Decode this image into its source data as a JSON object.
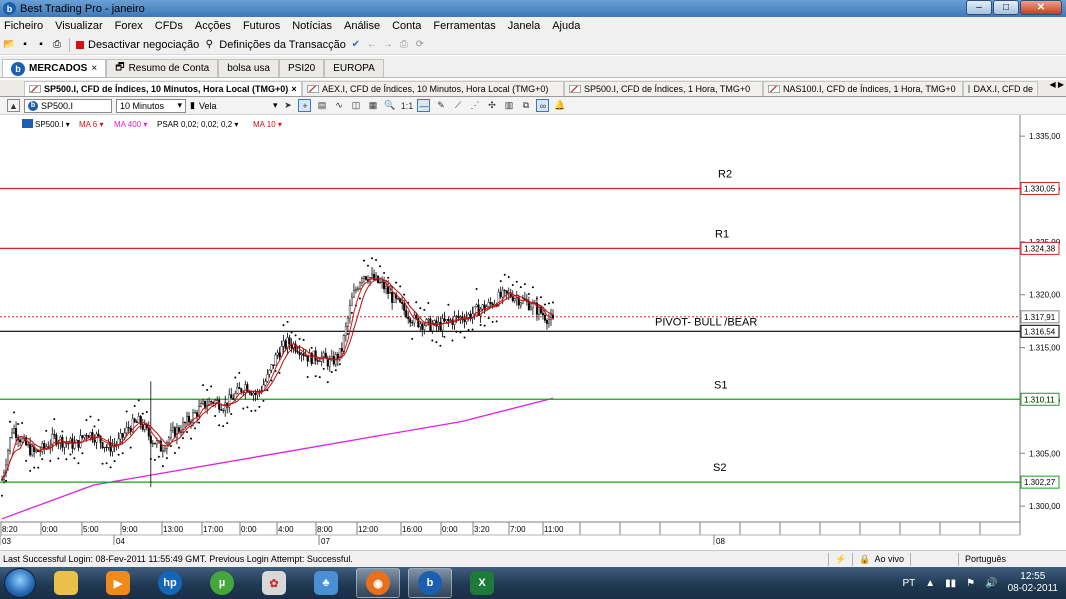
{
  "window": {
    "title": "Best Trading Pro - janeiro",
    "min": "–",
    "max": "□",
    "close": "✕",
    "app_icon": "b"
  },
  "menu": [
    "Ficheiro",
    "Visualizar",
    "Forex",
    "CFDs",
    "Acções",
    "Futuros",
    "Notícias",
    "Análise",
    "Conta",
    "Ferramentas",
    "Janela",
    "Ajuda"
  ],
  "toolbar": {
    "deactivate": "Desactivar negociação",
    "settings": "Definições da Transacção"
  },
  "main_tabs": [
    {
      "label": "MERCADOS",
      "active": true,
      "close": "×"
    },
    {
      "label": "Resumo de Conta"
    },
    {
      "label": "bolsa usa"
    },
    {
      "label": "PSI20"
    },
    {
      "label": "EUROPA"
    }
  ],
  "chart_tabs": [
    {
      "label": "SP500.I, CFD de Índices, 10 Minutos, Hora Local (TMG+0)",
      "active": true,
      "close": "×"
    },
    {
      "label": "AEX.I, CFD de Índices, 10 Minutos, Hora Local (TMG+0)"
    },
    {
      "label": "SP500.I, CFD de Índices, 1 Hora, TMG+0"
    },
    {
      "label": "NAS100.I, CFD de Índices, 1 Hora, TMG+0"
    },
    {
      "label": "DAX.I, CFD de"
    }
  ],
  "chart_toolbar": {
    "symbol": "SP500.I",
    "interval": "10 Minutos",
    "chart_type": "Vela"
  },
  "legend": {
    "symbol": "SP500.I ▾",
    "ma6": "MA 6 ▾",
    "ma400": "MA 400 ▾",
    "psar": "PSAR 0,02; 0,02; 0,2 ▾",
    "ma10": "MA 10 ▾"
  },
  "status": {
    "login": "Last Successful Login: 08-Fev-2011 11:55:49 GMT. Previous Login Attempt: Successful.",
    "live": "Ao vivo",
    "language": "Português"
  },
  "taskbar": {
    "lang": "PT",
    "time": "12:55",
    "date": "08-02-2011"
  },
  "colors": {
    "resistance": "#e02020",
    "support": "#18a018",
    "pivot": "#000000",
    "ma400": "#e020e0",
    "ma_red": "#d81414"
  },
  "chart_data": {
    "type": "candlestick",
    "instrument": "SP500.I",
    "ylim": [
      1298.5,
      1337.0
    ],
    "y_ticks": [
      "1.335,00",
      "1.330,00",
      "1.325,00",
      "1.320,00",
      "1.315,00",
      "1.310,00",
      "1.305,00",
      "1.300,00"
    ],
    "x_ticks": [
      "8:20",
      "0:00",
      "5:00",
      "9:00",
      "13:00",
      "17:00",
      "0:00",
      "4:00",
      "8:00",
      "12:00",
      "16:00",
      "0:00",
      "3:20",
      "7:00",
      "11:00"
    ],
    "date_labels": [
      "03",
      "04",
      "07",
      "08"
    ],
    "levels": [
      {
        "name": "R2",
        "value": 1330.05,
        "label": "1.330,05",
        "color": "#e02020"
      },
      {
        "name": "R1",
        "value": 1324.38,
        "label": "1.324,38",
        "color": "#e02020"
      },
      {
        "name": "PIVOT- BULL /BEAR",
        "value": 1316.54,
        "label": "1.316,54",
        "color": "#000000"
      },
      {
        "name": "S1",
        "value": 1310.11,
        "label": "1.310,11",
        "color": "#18a018"
      },
      {
        "name": "S2",
        "value": 1302.27,
        "label": "1.302,27",
        "color": "#18a018"
      }
    ],
    "current_price": {
      "value": 1317.91,
      "label": "1.317,91"
    },
    "price_path": [
      1302.5,
      1307.5,
      1306.0,
      1305.0,
      1305.5,
      1306.5,
      1306.0,
      1305.8,
      1307.0,
      1306.5,
      1305.5,
      1306.0,
      1307.5,
      1308.0,
      1306.5,
      1305.5,
      1306.8,
      1307.5,
      1308.5,
      1309.5,
      1310.0,
      1309.5,
      1310.5,
      1311.5,
      1310.5,
      1312.0,
      1314.5,
      1315.5,
      1315.0,
      1314.0,
      1314.2,
      1313.5,
      1314.5,
      1319.5,
      1322.0,
      1321.5,
      1320.8,
      1319.5,
      1318.5,
      1317.5,
      1317.2,
      1317.0,
      1317.4,
      1317.8,
      1318.0,
      1318.6,
      1319.0,
      1319.8,
      1320.0,
      1319.5,
      1319.0,
      1318.2,
      1317.4
    ],
    "ma400_path": [
      1298.8,
      1302.0,
      1303.5,
      1305.0,
      1306.5,
      1308.0,
      1310.2
    ]
  }
}
